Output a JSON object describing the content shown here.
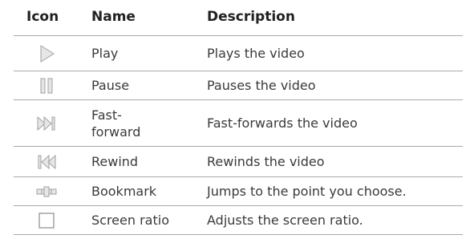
{
  "table": {
    "headers": {
      "icon": "Icon",
      "name": "Name",
      "description": "Description"
    },
    "rows": [
      {
        "icon": "play-icon",
        "name": "Play",
        "description": "Plays the video"
      },
      {
        "icon": "pause-icon",
        "name": "Pause",
        "description": "Pauses the video"
      },
      {
        "icon": "fast-forward-icon",
        "name": "Fast-\nforward",
        "description": "Fast-forwards the video"
      },
      {
        "icon": "rewind-icon",
        "name": "Rewind",
        "description": "Rewinds the video"
      },
      {
        "icon": "bookmark-icon",
        "name": "Bookmark",
        "description": "Jumps to the point you choose."
      },
      {
        "icon": "screen-ratio-icon",
        "name": "Screen ratio",
        "description": "Adjusts the screen ratio."
      }
    ]
  },
  "colors": {
    "icon_fill": "#e6e6e6",
    "icon_stroke": "#9a9a9a",
    "rule": "#a9a9a9",
    "text": "#3a3a3a"
  }
}
